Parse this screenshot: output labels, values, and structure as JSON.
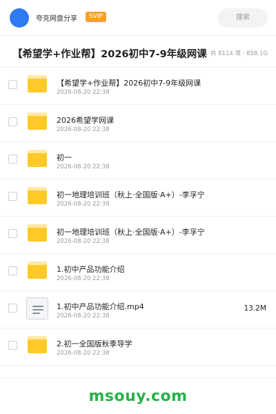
{
  "topbar": {
    "username": "夸克网盘分享",
    "badge": "SVIP",
    "search_placeholder": "搜索"
  },
  "share": {
    "title": "【希望学+作业帮】2026初中7-9年级网课",
    "meta": "共 8114 项 · 858.1G"
  },
  "files": [
    {
      "name": "【希望学+作业帮】2026初中7-9年级网课",
      "date": "2026-08-20 22:38",
      "type": "folder",
      "size": ""
    },
    {
      "name": "2026希望学网课",
      "date": "2026-08-20 22:38",
      "type": "folder",
      "size": ""
    },
    {
      "name": "初一",
      "date": "2026-08-20 22:38",
      "type": "folder",
      "size": ""
    },
    {
      "name": "初一地理培训班（秋上·全国版·A+）-李孚宁",
      "date": "2026-08-20 22:38",
      "type": "folder",
      "size": ""
    },
    {
      "name": "初一地理培训班（秋上·全国版·A+）-李孚宁",
      "date": "2026-08-20 22:38",
      "type": "folder",
      "size": ""
    },
    {
      "name": "1.初中产品功能介绍",
      "date": "2026-08-20 22:38",
      "type": "folder",
      "size": ""
    },
    {
      "name": "1.初中产品功能介绍.mp4",
      "date": "2026-08-20 22:38",
      "type": "video-file",
      "size": "13.2M"
    },
    {
      "name": "2.初一全国版秋季导学",
      "date": "2026-08-20 22:38",
      "type": "folder",
      "size": ""
    }
  ],
  "footer": {
    "watermark": "msouy.com",
    "watermark_color": "#27b24a"
  }
}
